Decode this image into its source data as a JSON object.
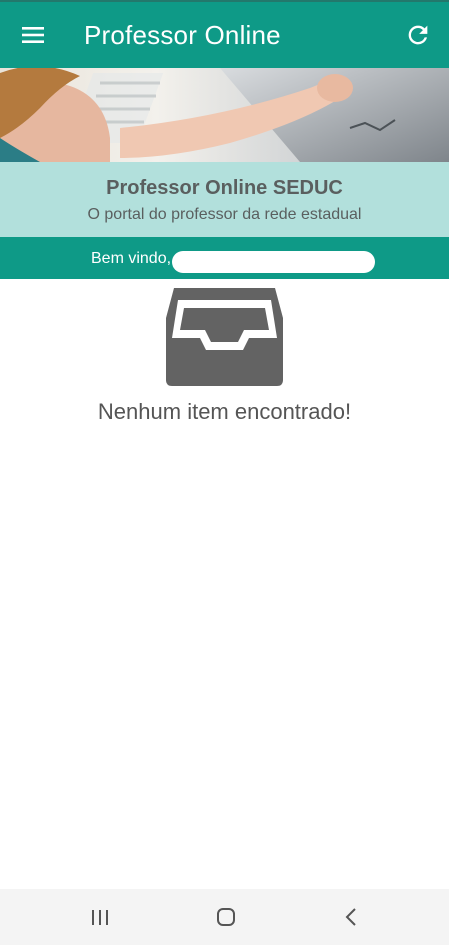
{
  "app_bar": {
    "title": "Professor Online",
    "menu_icon": "hamburger-menu-icon",
    "refresh_icon": "refresh-icon",
    "background": "#0e9a87"
  },
  "banner": {
    "image": "teacher-writing-on-whiteboard"
  },
  "portal": {
    "title": "Professor Online SEDUC",
    "subtitle": "O portal do professor da rede estadual",
    "background": "#b2e0dc"
  },
  "welcome": {
    "text": "Bem vindo,",
    "name_redacted": true
  },
  "empty_state": {
    "icon": "inbox-tray-icon",
    "message": "Nenhum item encontrado!"
  },
  "system_nav": {
    "recents_icon": "recents-icon",
    "home_icon": "home-icon",
    "back_icon": "back-icon"
  }
}
